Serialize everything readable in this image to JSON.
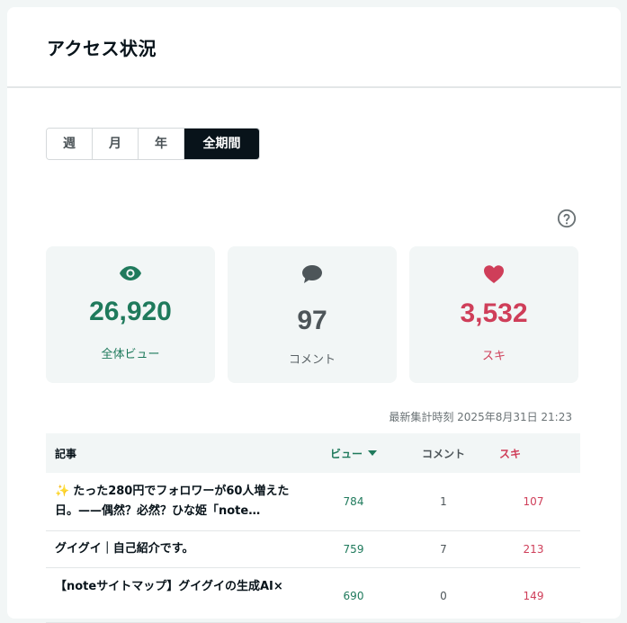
{
  "panel": {
    "title": "アクセス状況"
  },
  "periods": [
    {
      "label": "週",
      "active": false
    },
    {
      "label": "月",
      "active": false
    },
    {
      "label": "年",
      "active": false
    },
    {
      "label": "全期間",
      "active": true
    }
  ],
  "help_icon": "question-circle-icon",
  "stats": {
    "views": {
      "value": "26,920",
      "label": "全体ビュー",
      "icon": "eye-icon",
      "color": "#1f7a5c"
    },
    "comments": {
      "value": "97",
      "label": "コメント",
      "icon": "speech-bubble-icon",
      "color": "#4d5559"
    },
    "likes": {
      "value": "3,532",
      "label": "スキ",
      "icon": "heart-icon",
      "color": "#cf3e59"
    }
  },
  "timestamp": "最新集計時刻 2025年8月31日 21:23",
  "table": {
    "headers": {
      "title": "記事",
      "views": "ビュー",
      "comments": "コメント",
      "likes": "スキ"
    },
    "rows": [
      {
        "emoji": "✨",
        "title": "たった280円でフォロワーが60人増えた日。——偶然？必然？ひな姫「note…",
        "views": "784",
        "comments": "1",
        "likes": "107"
      },
      {
        "emoji": "",
        "title": "グイグイ｜自己紹介です。",
        "views": "759",
        "comments": "7",
        "likes": "213"
      },
      {
        "emoji": "",
        "title": "【noteサイトマップ】グイグイの生成AI×",
        "views": "690",
        "comments": "0",
        "likes": "149"
      }
    ]
  }
}
